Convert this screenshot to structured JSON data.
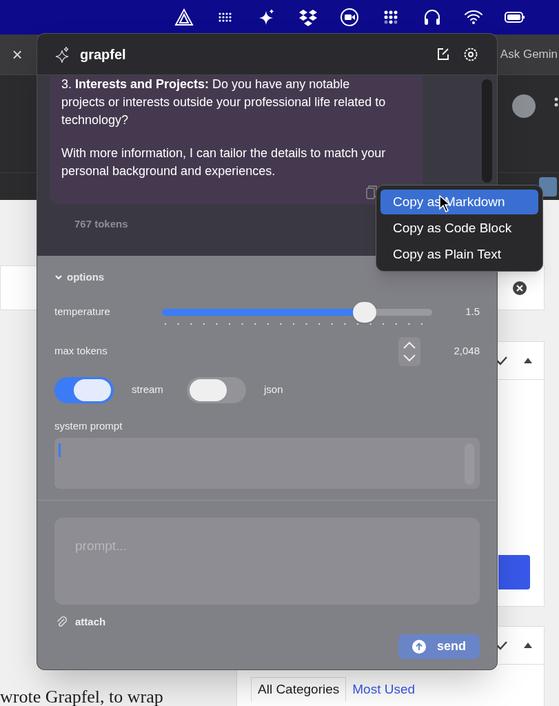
{
  "browser": {
    "tab_close": "×",
    "tab": {
      "label": "Ask Gemin"
    }
  },
  "panel": {
    "title": "grapfel",
    "message": {
      "paragraphs": [
        "3. **Interests and Projects:** Do you have any notable projects or interests outside your professional life related to technology?",
        "With more information, I can tailor the details to match your personal background and experiences."
      ]
    },
    "token_count": "767 tokens",
    "copy_menu": [
      {
        "label": "Copy as Markdown",
        "selected": true
      },
      {
        "label": "Copy as Code Block",
        "selected": false
      },
      {
        "label": "Copy as Plain Text",
        "selected": false
      }
    ],
    "options": {
      "label": "options",
      "expanded": true,
      "temperature": {
        "label": "temperature",
        "level": 0.75,
        "reading": "1.5"
      },
      "max_tokens": {
        "label": "max tokens",
        "value": "2,048"
      },
      "toggles": [
        {
          "label": "stream",
          "on": true
        },
        {
          "label": "json",
          "on": false
        }
      ],
      "system_prompt": {
        "label": "system prompt"
      }
    },
    "prompt": {
      "placeholder": "prompt..."
    },
    "attach": "attach",
    "send": "send"
  },
  "editor": {
    "body_text": "wrote Grapfel, to wrap",
    "category_tabs": [
      {
        "label": "All Categories",
        "selected": true
      },
      {
        "label": "Most Used",
        "selected": false
      }
    ]
  }
}
